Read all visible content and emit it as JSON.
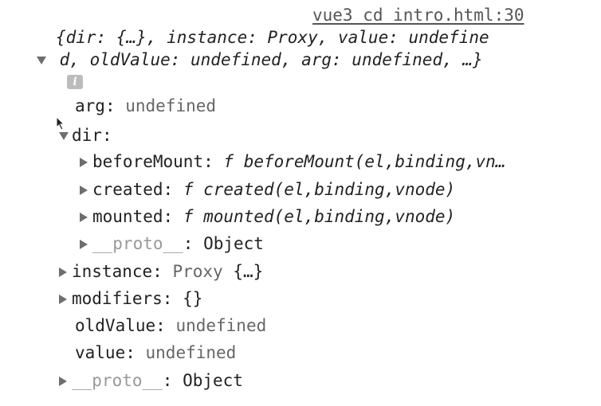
{
  "source_link": "vue3 cd intro.html:30",
  "summary": {
    "line1": "{dir: {…}, instance: Proxy, value: undefine",
    "line2": "d, oldValue: undefined, arg: undefined, …}"
  },
  "info_glyph": "i",
  "props": {
    "arg": {
      "key": "arg",
      "value": "undefined"
    },
    "dir": {
      "key": "dir"
    },
    "beforeMount": {
      "key": "beforeMount",
      "f": "f",
      "sig": "beforeMount(el,binding,vn…"
    },
    "created": {
      "key": "created",
      "f": "f",
      "sig": "created(el,binding,vnode)"
    },
    "mounted": {
      "key": "mounted",
      "f": "f",
      "sig": "mounted(el,binding,vnode)"
    },
    "dir_proto": {
      "key": "__proto__",
      "value": "Object"
    },
    "instance": {
      "key": "instance",
      "type": "Proxy",
      "value": "{…}"
    },
    "modifiers": {
      "key": "modifiers",
      "value": "{}"
    },
    "oldValue": {
      "key": "oldValue",
      "value": "undefined"
    },
    "value": {
      "key": "value",
      "value": "undefined"
    },
    "proto": {
      "key": "__proto__",
      "value": "Object"
    }
  }
}
